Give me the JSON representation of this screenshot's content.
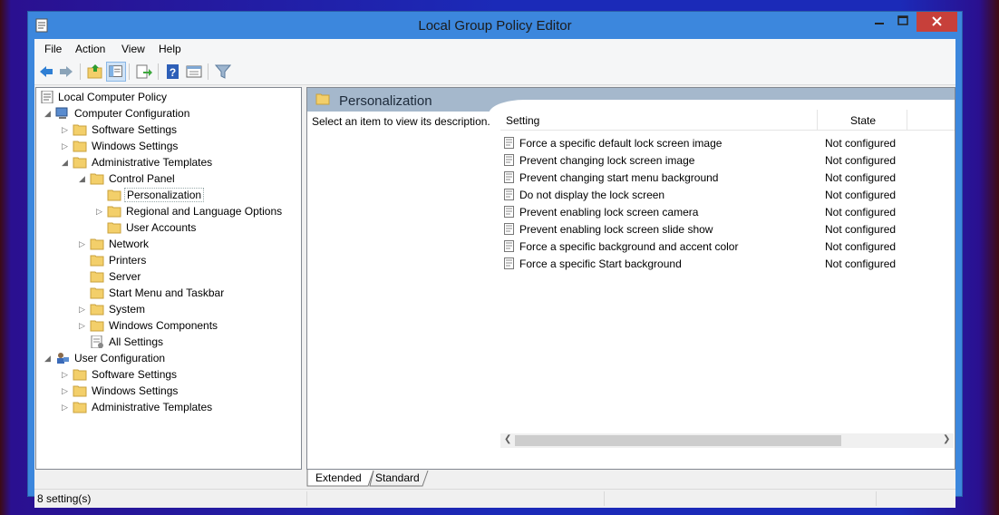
{
  "window": {
    "title": "Local Group Policy Editor"
  },
  "menu": [
    "File",
    "Action",
    "View",
    "Help"
  ],
  "toolbar": [
    "back-icon",
    "forward-icon",
    "up-folder-icon",
    "show-hide-tree-icon",
    "export-list-icon",
    "help-icon",
    "properties-icon",
    "filter-icon"
  ],
  "tree": [
    {
      "label": "Local Computer Policy"
    },
    {
      "label": "Computer Configuration"
    },
    {
      "label": "Software Settings"
    },
    {
      "label": "Windows Settings"
    },
    {
      "label": "Administrative Templates"
    },
    {
      "label": "Control Panel"
    },
    {
      "label": "Personalization"
    },
    {
      "label": "Regional and Language Options"
    },
    {
      "label": "User Accounts"
    },
    {
      "label": "Network"
    },
    {
      "label": "Printers"
    },
    {
      "label": "Server"
    },
    {
      "label": "Start Menu and Taskbar"
    },
    {
      "label": "System"
    },
    {
      "label": "Windows Components"
    },
    {
      "label": "All Settings"
    },
    {
      "label": "User Configuration"
    },
    {
      "label": "Software Settings"
    },
    {
      "label": "Windows Settings"
    },
    {
      "label": "Administrative Templates"
    }
  ],
  "details": {
    "title": "Personalization",
    "description": "Select an item to view its description.",
    "columns": [
      "Setting",
      "State"
    ],
    "rows": [
      {
        "setting": "Force a specific default lock screen image",
        "state": "Not configured"
      },
      {
        "setting": "Prevent changing lock screen image",
        "state": "Not configured"
      },
      {
        "setting": "Prevent changing start menu background",
        "state": "Not configured"
      },
      {
        "setting": "Do not display the lock screen",
        "state": "Not configured"
      },
      {
        "setting": "Prevent enabling lock screen camera",
        "state": "Not configured"
      },
      {
        "setting": "Prevent enabling lock screen slide show",
        "state": "Not configured"
      },
      {
        "setting": "Force a specific background and accent color",
        "state": "Not configured"
      },
      {
        "setting": "Force a specific Start background",
        "state": "Not configured"
      }
    ]
  },
  "tabs": [
    "Extended",
    "Standard"
  ],
  "status": {
    "text": "8 setting(s)"
  },
  "colors": {
    "titlebar": "#3c87dd",
    "close": "#c7403a",
    "header_band": "#a5b8cc",
    "folder": "#f3cf6a"
  }
}
